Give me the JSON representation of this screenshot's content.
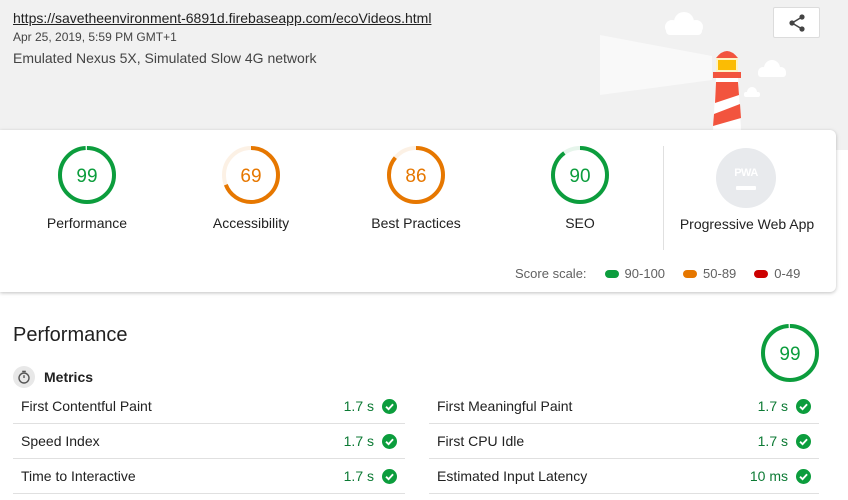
{
  "report": {
    "url": "https://savetheenvironment-6891d.firebaseapp.com/ecoVideos.html",
    "date": "Apr 25, 2019, 5:59 PM GMT+1",
    "environment": "Emulated Nexus 5X, Simulated Slow 4G network",
    "share_icon": "share-icon"
  },
  "colors": {
    "pass": "#0c9d3d",
    "average": "#e67700",
    "fail": "#cc0000",
    "neutral": "#dadce0"
  },
  "categories": [
    {
      "label": "Performance",
      "score": 99,
      "rating": "pass"
    },
    {
      "label": "Accessibility",
      "score": 69,
      "rating": "average"
    },
    {
      "label": "Best Practices",
      "score": 86,
      "rating": "average"
    },
    {
      "label": "SEO",
      "score": 90,
      "rating": "pass"
    }
  ],
  "pwa": {
    "label": "Progressive Web App",
    "badge_text": "PWA"
  },
  "score_scale": {
    "label": "Score scale:",
    "ranges": [
      {
        "label": "90-100",
        "color": "#0c9d3d"
      },
      {
        "label": "50-89",
        "color": "#e67700"
      },
      {
        "label": "0-49",
        "color": "#cc0000"
      }
    ]
  },
  "performance": {
    "title": "Performance",
    "score": 99,
    "metrics_heading": "Metrics",
    "metrics": [
      {
        "name": "First Contentful Paint",
        "value": "1.7 s"
      },
      {
        "name": "First Meaningful Paint",
        "value": "1.7 s"
      },
      {
        "name": "Speed Index",
        "value": "1.7 s"
      },
      {
        "name": "First CPU Idle",
        "value": "1.7 s"
      },
      {
        "name": "Time to Interactive",
        "value": "1.7 s"
      },
      {
        "name": "Estimated Input Latency",
        "value": "10 ms"
      }
    ]
  }
}
